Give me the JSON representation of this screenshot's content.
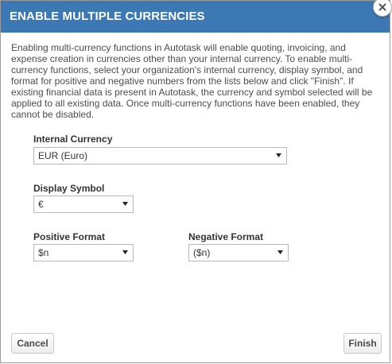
{
  "dialog": {
    "title": "ENABLE MULTIPLE CURRENCIES",
    "description": "Enabling multi-currency functions in Autotask will enable quoting, invoicing, and expense creation in currencies other than your internal currency. To enable multi-currency functions, select your organization's internal currency, display symbol, and format for positive and negative numbers from the lists below and click \"Finish\". If existing financial data is present in Autotask, the currency and symbol selected will be applied to all existing data. Once multi-currency functions have been enabled, they cannot be disabled."
  },
  "fields": {
    "internal_currency": {
      "label": "Internal Currency",
      "value": "EUR (Euro)"
    },
    "display_symbol": {
      "label": "Display Symbol",
      "value": "€"
    },
    "positive_format": {
      "label": "Positive Format",
      "value": "$n"
    },
    "negative_format": {
      "label": "Negative Format",
      "value": "($n)"
    }
  },
  "buttons": {
    "cancel": "Cancel",
    "finish": "Finish"
  },
  "colors": {
    "titlebar": "#3c78b4",
    "title_text": "#ffffff"
  },
  "icons": {
    "close": "close-icon",
    "dropdown": "caret-down-icon"
  }
}
